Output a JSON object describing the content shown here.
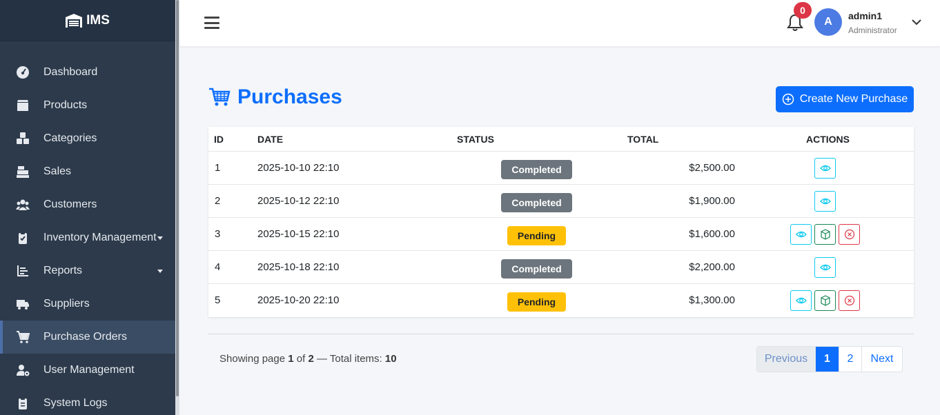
{
  "brand": {
    "name": "IMS"
  },
  "sidebar": {
    "items": [
      {
        "label": "Dashboard",
        "icon": "dashboard-gauge-icon"
      },
      {
        "label": "Products",
        "icon": "box-icon"
      },
      {
        "label": "Categories",
        "icon": "cubes-icon"
      },
      {
        "label": "Sales",
        "icon": "cash-register-icon"
      },
      {
        "label": "Customers",
        "icon": "users-icon"
      },
      {
        "label": "Inventory Management",
        "icon": "clipboard-check-icon",
        "has_submenu": true
      },
      {
        "label": "Reports",
        "icon": "bar-chart-icon",
        "has_submenu": true
      },
      {
        "label": "Suppliers",
        "icon": "truck-icon"
      },
      {
        "label": "Purchase Orders",
        "icon": "cart-icon",
        "active": true
      },
      {
        "label": "User Management",
        "icon": "user-gear-icon"
      },
      {
        "label": "System Logs",
        "icon": "clipboard-list-icon"
      }
    ]
  },
  "header": {
    "notifications_count": "0",
    "user": {
      "initial": "A",
      "name": "admin1",
      "role": "Administrator"
    }
  },
  "main": {
    "title": "Purchases",
    "create_button": "Create New Purchase",
    "columns": {
      "id": "ID",
      "date": "DATE",
      "status": "STATUS",
      "total": "TOTAL",
      "actions": "ACTIONS"
    },
    "rows": [
      {
        "id": "1",
        "date": "2025-10-10 22:10",
        "status": "Completed",
        "total": "$2,500.00"
      },
      {
        "id": "2",
        "date": "2025-10-12 22:10",
        "status": "Completed",
        "total": "$1,900.00"
      },
      {
        "id": "3",
        "date": "2025-10-15 22:10",
        "status": "Pending",
        "total": "$1,600.00"
      },
      {
        "id": "4",
        "date": "2025-10-18 22:10",
        "status": "Completed",
        "total": "$2,200.00"
      },
      {
        "id": "5",
        "date": "2025-10-20 22:10",
        "status": "Pending",
        "total": "$1,300.00"
      }
    ],
    "pagination_info": {
      "prefix": "Showing page",
      "current": "1",
      "of": "of",
      "total_pages": "2",
      "sep": "— Total items:",
      "total_items": "10"
    },
    "pager": {
      "previous": "Previous",
      "pages": [
        "1",
        "2"
      ],
      "next": "Next"
    }
  },
  "colors": {
    "primary": "#0d6efd",
    "sidebar": "#2c3a4b",
    "completed": "#6c757d",
    "pending": "#ffc107",
    "danger": "#dc3545",
    "info": "#0dcaf0",
    "success": "#198754"
  }
}
